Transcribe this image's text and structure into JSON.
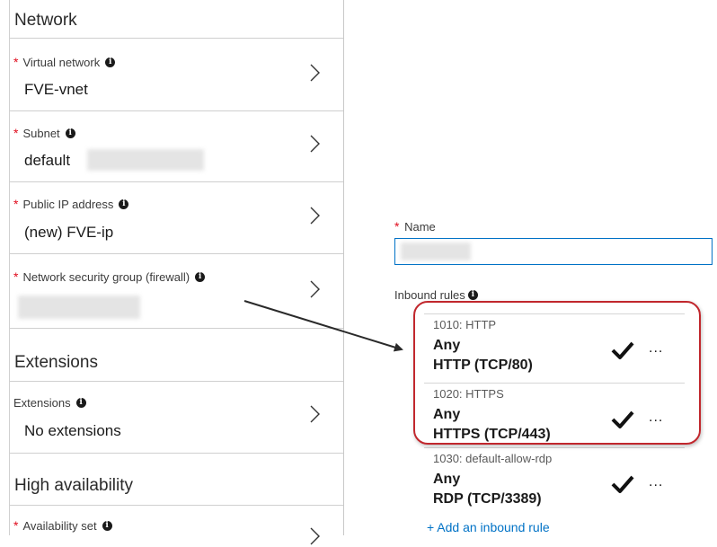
{
  "network": {
    "section_title": "Network",
    "virtual_network": {
      "label": "Virtual network",
      "value": "FVE-vnet"
    },
    "subnet": {
      "label": "Subnet",
      "value": "default"
    },
    "public_ip": {
      "label": "Public IP address",
      "value": "(new) FVE-ip"
    },
    "nsg": {
      "label": "Network security group (firewall)"
    }
  },
  "extensions": {
    "section_title": "Extensions",
    "field": {
      "label": "Extensions",
      "value": "No extensions"
    }
  },
  "high_availability": {
    "section_title": "High availability",
    "availability_set": {
      "label": "Availability set"
    }
  },
  "nsg_blade": {
    "name_label": "Name",
    "inbound_label": "Inbound rules",
    "rules": [
      {
        "name": "1010: HTTP",
        "source": "Any",
        "service": "HTTP (TCP/80)"
      },
      {
        "name": "1020: HTTPS",
        "source": "Any",
        "service": "HTTPS (TCP/443)"
      },
      {
        "name": "1030: default-allow-rdp",
        "source": "Any",
        "service": "RDP (TCP/3389)"
      }
    ],
    "add_rule": "+ Add an inbound rule"
  },
  "colors": {
    "required": "#e00b1c",
    "link": "#0072c6",
    "highlight": "#c1272d"
  },
  "icons": [
    "info-icon",
    "chevron-right-icon",
    "checkmark-icon",
    "more-icon"
  ]
}
